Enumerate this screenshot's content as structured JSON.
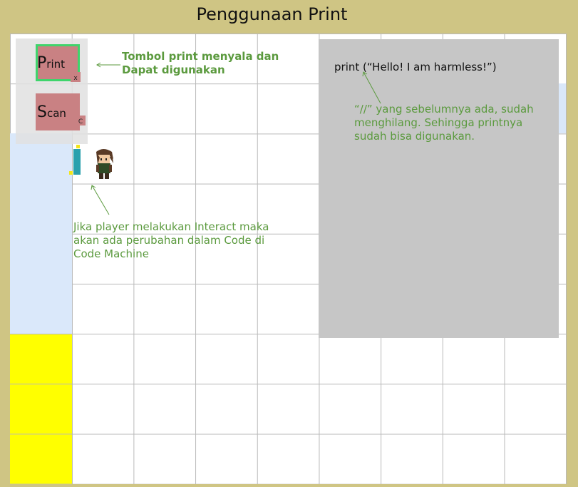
{
  "title": "Penggunaan Print",
  "hud": {
    "print_key": {
      "big": "P",
      "small": "rint",
      "hint": "x"
    },
    "scan_key": {
      "big": "S",
      "small": "can",
      "hint": "C"
    }
  },
  "notes": {
    "print_note": "Tombol print menyala dan Dapat digunakan",
    "interact_note": "Jika player melakukan Interact maka akan ada perubahan dalam Code di Code Machine",
    "code_note": "“//” yang sebelumnya ada, sudah menghilang. Sehingga printnya sudah bisa digunakan."
  },
  "code_panel": {
    "line": "print (“Hello! I am harmless!”)"
  },
  "colors": {
    "background": "#cfc584",
    "key_button": "#c98183",
    "active_outline": "#3fd46c",
    "note_text": "#5b9a3e",
    "code_panel": "#c6c6c6",
    "blue_tiles": "#dae8fa",
    "yellow_tiles": "#ffff00",
    "machine": "#2aa1ad"
  },
  "icons": {
    "player": "player-character-sprite",
    "machine": "code-machine-icon"
  }
}
